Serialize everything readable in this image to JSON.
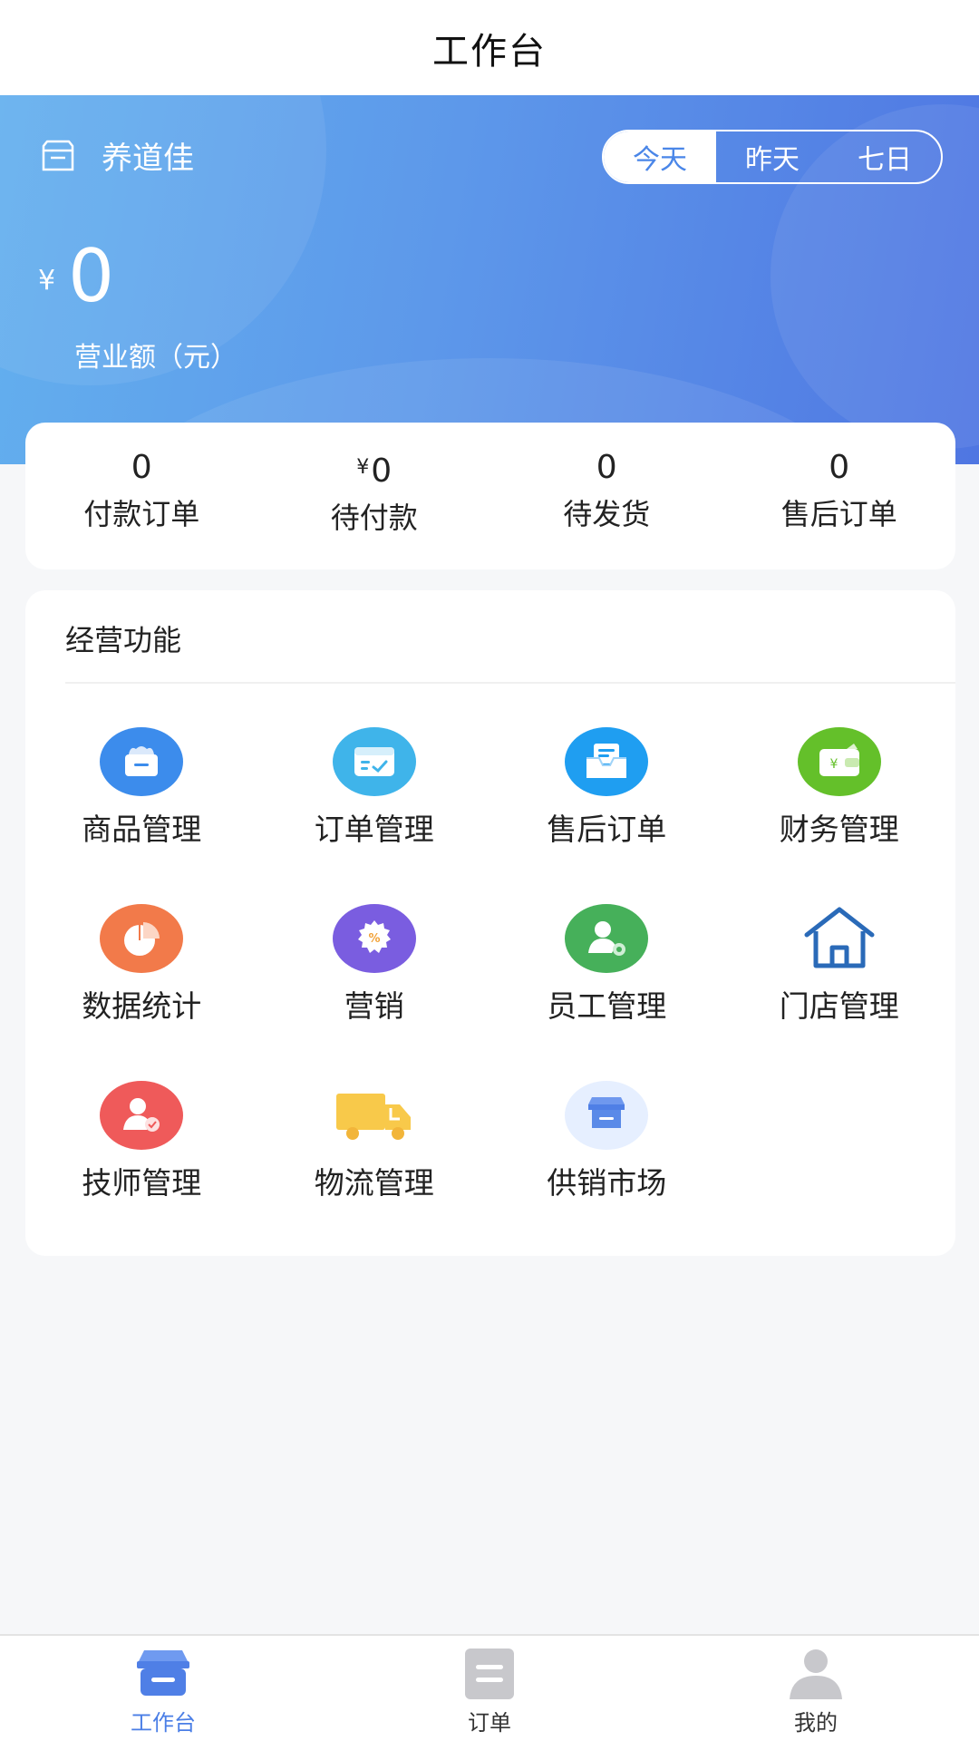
{
  "header": {
    "title": "工作台"
  },
  "hero": {
    "store_name": "养道佳",
    "periods": [
      {
        "label": "今天",
        "active": true
      },
      {
        "label": "昨天",
        "active": false
      },
      {
        "label": "七日",
        "active": false
      }
    ],
    "currency": "¥",
    "revenue": "0",
    "revenue_label": "营业额（元）"
  },
  "stats": [
    {
      "value": "0",
      "label": "付款订单"
    },
    {
      "value": "0",
      "prefix": "¥",
      "label": "待付款"
    },
    {
      "value": "0",
      "label": "待发货"
    },
    {
      "value": "0",
      "label": "售后订单"
    }
  ],
  "functions": {
    "title": "经营功能",
    "items": [
      {
        "label": "商品管理",
        "icon": "basket-icon",
        "color": "#3c8cec"
      },
      {
        "label": "订单管理",
        "icon": "order-box-icon",
        "color": "#3fb4ea"
      },
      {
        "label": "售后订单",
        "icon": "inbox-icon",
        "color": "#1f9ef1"
      },
      {
        "label": "财务管理",
        "icon": "wallet-icon",
        "color": "#64c02a"
      },
      {
        "label": "数据统计",
        "icon": "pie-chart-icon",
        "color": "#f27a4a"
      },
      {
        "label": "营销",
        "icon": "discount-badge-icon",
        "color": "#7a5de0"
      },
      {
        "label": "员工管理",
        "icon": "staff-settings-icon",
        "color": "#46b05a"
      },
      {
        "label": "门店管理",
        "icon": "house-icon",
        "color": "#2a6ab8"
      },
      {
        "label": "技师管理",
        "icon": "technician-icon",
        "color": "#ef5a5a"
      },
      {
        "label": "物流管理",
        "icon": "truck-icon",
        "color": "#f8c94a"
      },
      {
        "label": "供销市场",
        "icon": "market-store-icon",
        "color": "#5585e6"
      }
    ]
  },
  "tabbar": [
    {
      "label": "工作台",
      "icon": "workbench-icon",
      "active": true
    },
    {
      "label": "订单",
      "icon": "order-list-icon",
      "active": false
    },
    {
      "label": "我的",
      "icon": "user-icon",
      "active": false
    }
  ]
}
